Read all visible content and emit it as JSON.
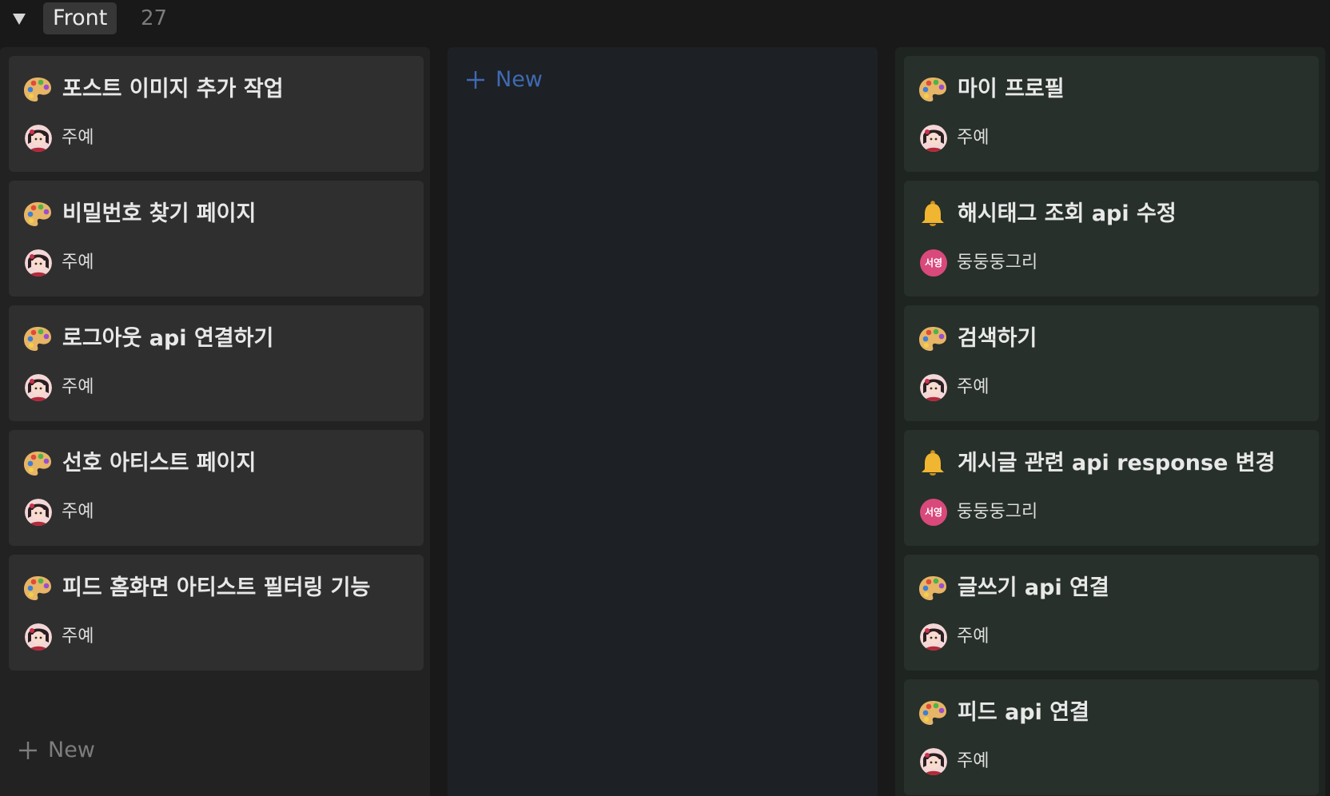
{
  "group": {
    "name": "Front",
    "count": "27",
    "toggle_icon": "triangle-down-icon"
  },
  "columns": [
    {
      "cards": [
        {
          "icon": "palette-icon",
          "title": "포스트 이미지 추가 작업",
          "person": "주예",
          "avatar": "photo"
        },
        {
          "icon": "palette-icon",
          "title": "비밀번호 찾기 페이지",
          "person": "주예",
          "avatar": "photo"
        },
        {
          "icon": "palette-icon",
          "title": "로그아웃 api 연결하기",
          "person": "주예",
          "avatar": "photo"
        },
        {
          "icon": "palette-icon",
          "title": "선호 아티스트 페이지",
          "person": "주예",
          "avatar": "photo"
        },
        {
          "icon": "palette-icon",
          "title": "피드 홈화면 아티스트 필터링 기능",
          "person": "주예",
          "avatar": "photo"
        }
      ],
      "new_label": "New"
    },
    {
      "cards": [],
      "new_label": "New"
    },
    {
      "cards": [
        {
          "icon": "palette-icon",
          "title": "마이 프로필",
          "person": "주예",
          "avatar": "photo"
        },
        {
          "icon": "bell-icon",
          "title": "해시태그 조회 api 수정",
          "person": "둥둥둥그리",
          "avatar": "initials",
          "initials": "서영"
        },
        {
          "icon": "palette-icon",
          "title": "검색하기",
          "person": "주예",
          "avatar": "photo"
        },
        {
          "icon": "bell-icon",
          "title": "게시글 관련 api response 변경",
          "person": "둥둥둥그리",
          "avatar": "initials",
          "initials": "서영"
        },
        {
          "icon": "palette-icon",
          "title": "글쓰기 api 연결",
          "person": "주예",
          "avatar": "photo"
        },
        {
          "icon": "palette-icon",
          "title": "피드 api 연결",
          "person": "주예",
          "avatar": "photo"
        }
      ]
    }
  ],
  "colors": {
    "background": "#191919",
    "card_gray": "#2f2f2f",
    "card_green": "#27302a",
    "new_blue": "#3f6ab3",
    "initials_pink": "#d9497b"
  }
}
